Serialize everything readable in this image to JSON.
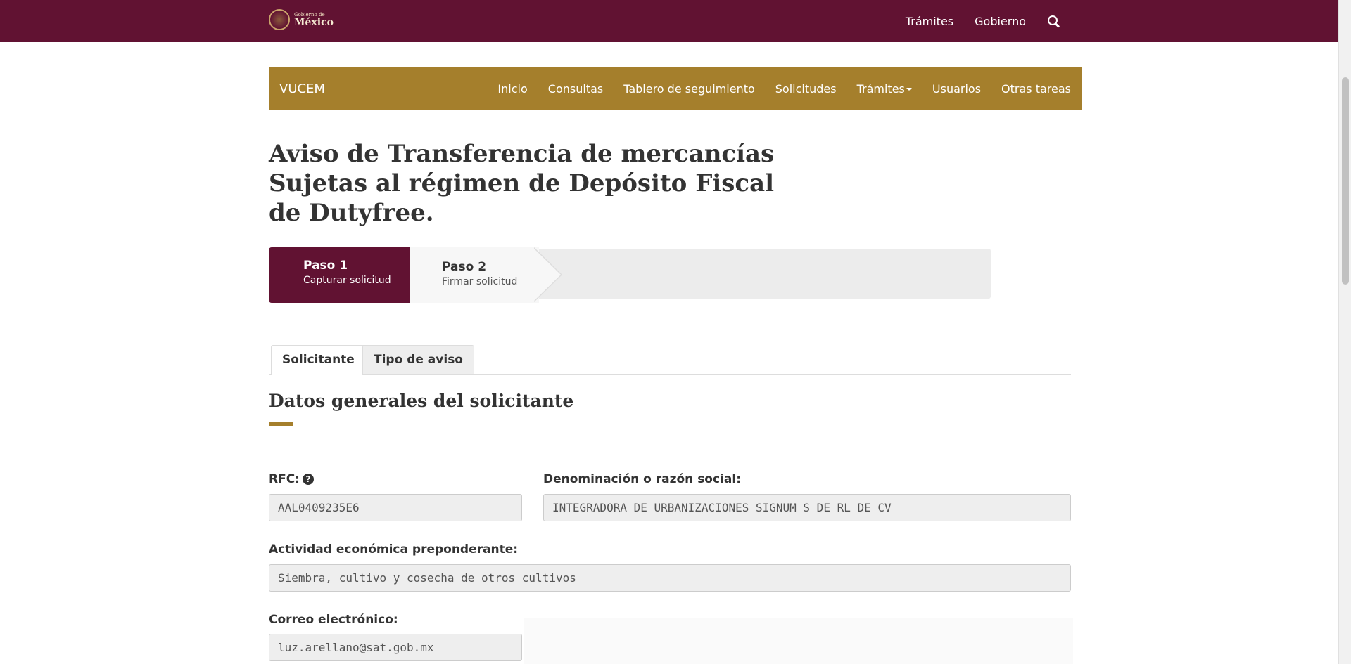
{
  "gov_header": {
    "logo_small": "Gobierno de",
    "logo_big": "México",
    "nav": [
      "Trámites",
      "Gobierno"
    ]
  },
  "vucem": {
    "brand": "VUCEM",
    "menu": {
      "inicio": "Inicio",
      "consultas": "Consultas",
      "tablero": "Tablero de seguimiento",
      "solicitudes": "Solicitudes",
      "tramites": "Trámites",
      "usuarios": "Usuarios",
      "otras": "Otras tareas"
    }
  },
  "page": {
    "title": "Aviso de Transferencia de mercancías Sujetas al régimen de Depósito Fiscal de Dutyfree."
  },
  "steps": [
    {
      "title": "Paso 1",
      "subtitle": "Capturar solicitud"
    },
    {
      "title": "Paso 2",
      "subtitle": "Firmar solicitud"
    }
  ],
  "tabs": [
    "Solicitante",
    "Tipo de aviso"
  ],
  "section": {
    "title": "Datos generales del solicitante"
  },
  "form": {
    "rfc_label": "RFC:",
    "rfc_value": "AAL0409235E6",
    "razon_label": "Denominación o razón social:",
    "razon_value": "INTEGRADORA DE URBANIZACIONES SIGNUM S DE RL DE CV",
    "actividad_label": "Actividad económica preponderante:",
    "actividad_value": "Siembra, cultivo y cosecha de otros cultivos",
    "correo_label": "Correo electrónico:",
    "correo_value": "luz.arellano@sat.gob.mx"
  },
  "colors": {
    "gov_bar": "#611232",
    "vucem_bar": "#a57f2c",
    "step_active": "#611232"
  }
}
